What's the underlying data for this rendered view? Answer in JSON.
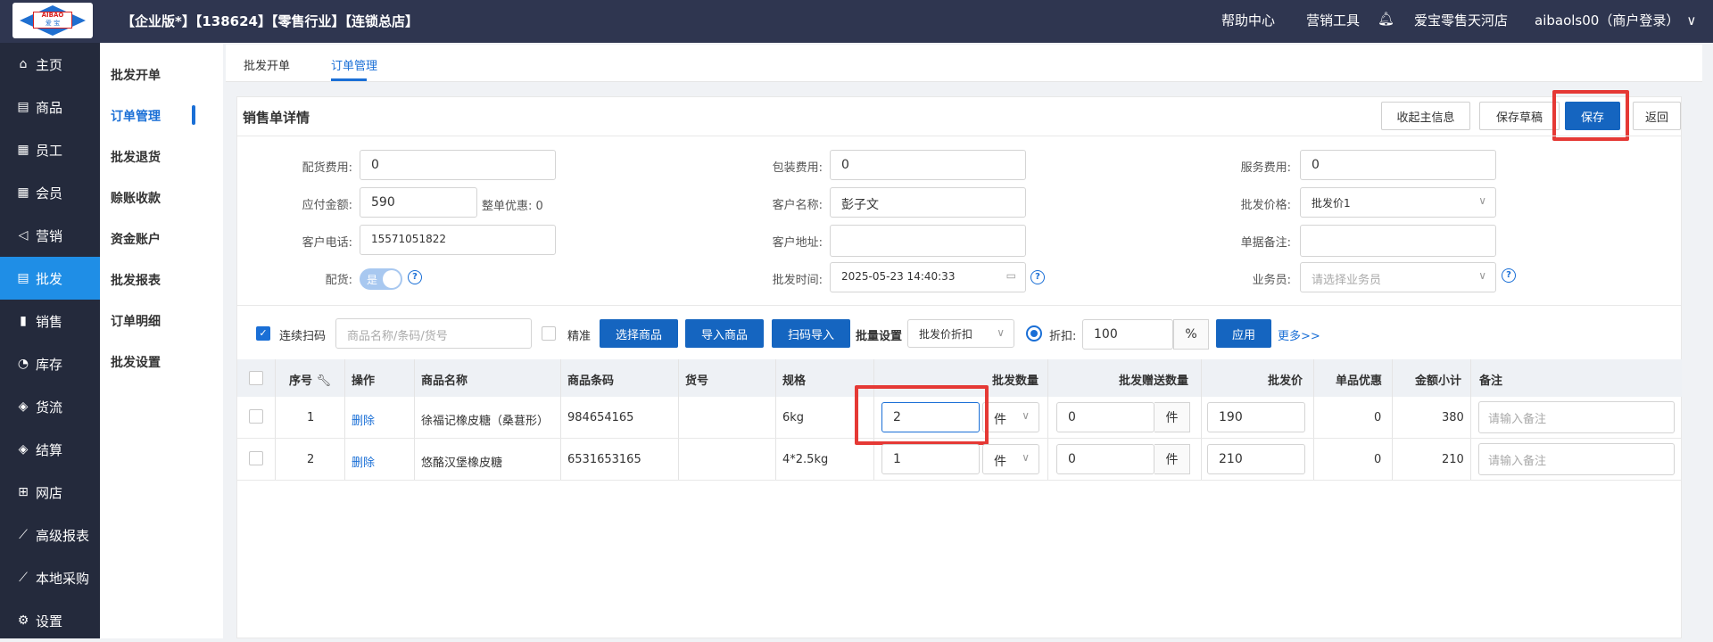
{
  "header": {
    "logo_text": "AIBAO",
    "logo_sub": "爱 宝",
    "title": "【企业版*】【138624】【零售行业】【连锁总店】",
    "help": "帮助中心",
    "marketing_tools": "营销工具",
    "store": "爱宝零售天河店",
    "user": "aibaols00（商户登录）"
  },
  "sidebar": {
    "items": [
      {
        "icon": "⌂",
        "label": "主页"
      },
      {
        "icon": "▤",
        "label": "商品"
      },
      {
        "icon": "▦",
        "label": "员工"
      },
      {
        "icon": "▦",
        "label": "会员"
      },
      {
        "icon": "◁",
        "label": "营销"
      },
      {
        "icon": "▤",
        "label": "批发"
      },
      {
        "icon": "▮",
        "label": "销售"
      },
      {
        "icon": "◔",
        "label": "库存"
      },
      {
        "icon": "◈",
        "label": "货流"
      },
      {
        "icon": "◈",
        "label": "结算"
      },
      {
        "icon": "⊞",
        "label": "网店"
      },
      {
        "icon": "⟋",
        "label": "高级报表"
      },
      {
        "icon": "⟋",
        "label": "本地采购"
      },
      {
        "icon": "⚙",
        "label": "设置"
      }
    ],
    "active_index": 5
  },
  "subnav": {
    "items": [
      "批发开单",
      "订单管理",
      "批发退货",
      "赊账收款",
      "资金账户",
      "批发报表",
      "订单明细",
      "批发设置"
    ],
    "active_index": 1
  },
  "tabs": [
    "批发开单",
    "订单管理"
  ],
  "detail": {
    "title": "销售单详情",
    "buttons": {
      "collapse": "收起主信息",
      "save_draft": "保存草稿",
      "save": "保存",
      "back": "返回"
    },
    "fields": {
      "delivery_fee_label": "配货费用:",
      "delivery_fee": "0",
      "payable_label": "应付金额:",
      "payable": "590",
      "discount_label": "整单优惠:",
      "discount": "0",
      "phone_label": "客户电话:",
      "phone": "15571051822",
      "delivery_label": "配货:",
      "delivery_toggle": "是",
      "packing_fee_label": "包装费用:",
      "packing_fee": "0",
      "customer_label": "客户名称:",
      "customer": "彭子文",
      "address_label": "客户地址:",
      "address": "",
      "time_label": "批发时间:",
      "time": "2025-05-23 14:40:33",
      "service_fee_label": "服务费用:",
      "service_fee": "0",
      "price_label": "批发价格:",
      "price": "批发价1",
      "remark_label": "单据备注:",
      "remark": "",
      "salesman_label": "业务员:",
      "salesman_placeholder": "请选择业务员"
    }
  },
  "toolbar": {
    "continuous_scan": "连续扫码",
    "search_placeholder": "商品名称/条码/货号",
    "exact": "精准",
    "select_goods": "选择商品",
    "import_goods": "导入商品",
    "scan_import": "扫码导入",
    "batch_setting": "批量设置",
    "batch_option": "批发价折扣",
    "discount_label": "折扣:",
    "discount_value": "100",
    "percent": "%",
    "apply": "应用",
    "more": "更多>>"
  },
  "table": {
    "headers": [
      "序号",
      "操作",
      "商品名称",
      "商品条码",
      "货号",
      "规格",
      "批发数量",
      "批发赠送数量",
      "批发价",
      "单品优惠",
      "金额小计",
      "备注"
    ],
    "remark_placeholder": "请输入备注",
    "rows": [
      {
        "no": "1",
        "action": "删除",
        "name": "徐福记橡皮糖（桑葚形）",
        "barcode": "984654165",
        "sku": "",
        "spec": "6kg",
        "qty": "2",
        "unit": "件",
        "gift_qty": "0",
        "gift_unit": "件",
        "price": "190",
        "item_discount": "0",
        "subtotal": "380"
      },
      {
        "no": "2",
        "action": "删除",
        "name": "悠酪汉堡橡皮糖",
        "barcode": "6531653165",
        "sku": "",
        "spec": "4*2.5kg",
        "qty": "1",
        "unit": "件",
        "gift_qty": "0",
        "gift_unit": "件",
        "price": "210",
        "item_discount": "0",
        "subtotal": "210"
      }
    ]
  }
}
